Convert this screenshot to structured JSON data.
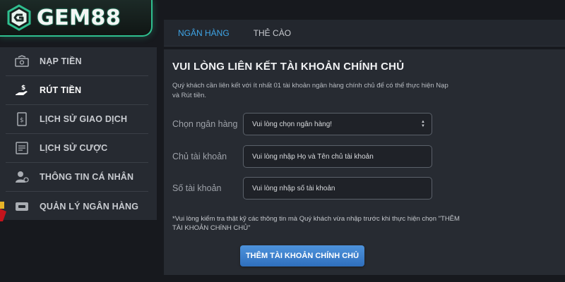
{
  "brand": {
    "name": "GEM88",
    "accent": "#2fbf8f"
  },
  "sidebar": {
    "items": [
      {
        "label": "NẠP TIỀN",
        "icon": "deposit-icon",
        "active": false
      },
      {
        "label": "RÚT TIỀN",
        "icon": "withdraw-hand-icon",
        "active": true
      },
      {
        "label": "LỊCH SỬ GIAO DỊCH",
        "icon": "transaction-history-icon",
        "active": false
      },
      {
        "label": "LỊCH SỬ CƯỢC",
        "icon": "bet-history-icon",
        "active": false
      },
      {
        "label": "THÔNG TIN CÁ NHÂN",
        "icon": "user-settings-icon",
        "active": false
      },
      {
        "label": "QUẢN LÝ NGÂN HÀNG",
        "icon": "bank-card-icon",
        "active": false
      }
    ]
  },
  "tabs": [
    {
      "label": "NGÂN HÀNG",
      "active": true
    },
    {
      "label": "THẺ CÀO",
      "active": false
    }
  ],
  "panel": {
    "title": "VUI LÒNG LIÊN KẾT TÀI KHOẢN CHÍNH CHỦ",
    "description": "Quý khách cần liên kết với ít nhất 01 tài khoản ngân hàng chính chủ để có thể thực hiện Nạp và Rút tiền.",
    "fields": {
      "bank": {
        "label": "Chọn ngân hàng",
        "value": "Vui lòng chọn ngân hàng!"
      },
      "holder": {
        "label": "Chủ tài khoản",
        "placeholder": "Vui lòng nhập Họ và Tên chủ tài khoản"
      },
      "number": {
        "label": "Số tài khoản",
        "placeholder": "Vui lòng nhập số tài khoản"
      }
    },
    "note": "*Vui lòng kiểm tra thật kỹ các thông tin mà Quý khách vừa nhập trước khi thực hiện chọn \"THÊM TÀI KHOẢN CHÍNH CHỦ\"",
    "submit_label": "THÊM TÀI KHOẢN CHÍNH CHỦ"
  },
  "colors": {
    "tab_active": "#3fa6e8",
    "button": "#3d82cf",
    "panel_bg": "#272b32",
    "sidebar_bg": "#262a31"
  }
}
